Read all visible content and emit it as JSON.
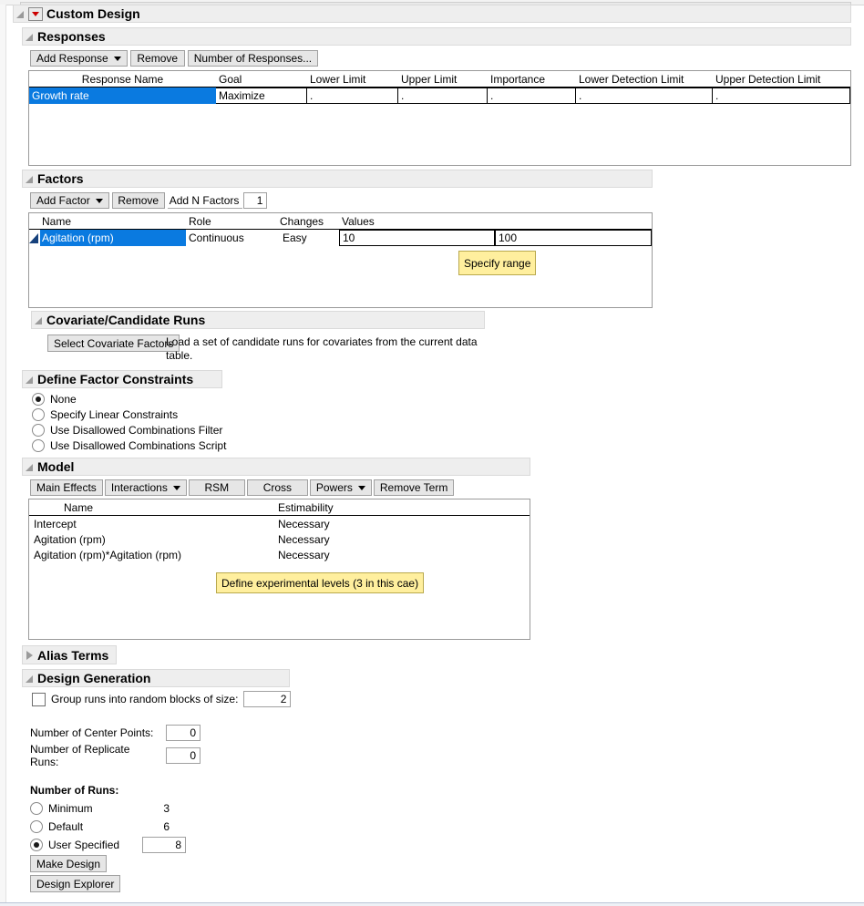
{
  "window": {
    "title": "Custom Design",
    "dropdown_icon": "red-triangle-dropdown-icon"
  },
  "responses": {
    "section_title": "Responses",
    "toolbar": {
      "add_response": "Add Response",
      "remove": "Remove",
      "number_of_responses": "Number of Responses..."
    },
    "columns": [
      "Response Name",
      "Goal",
      "Lower Limit",
      "Upper Limit",
      "Importance",
      "Lower Detection Limit",
      "Upper Detection Limit"
    ],
    "rows": [
      {
        "name": "Growth rate",
        "goal": "Maximize",
        "lower_limit": ".",
        "upper_limit": ".",
        "importance": ".",
        "lower_detection_limit": ".",
        "upper_detection_limit": "."
      }
    ]
  },
  "factors": {
    "section_title": "Factors",
    "toolbar": {
      "add_factor": "Add Factor",
      "remove": "Remove",
      "add_n_factors": "Add N Factors",
      "add_n_factors_value": "1"
    },
    "columns": [
      "Name",
      "Role",
      "Changes",
      "Values"
    ],
    "rows": [
      {
        "name": "Agitation (rpm)",
        "role": "Continuous",
        "changes": "Easy",
        "value_low": "10",
        "value_high": "100"
      }
    ],
    "callout": "Specify range"
  },
  "covariate": {
    "section_title": "Covariate/Candidate Runs",
    "button": "Select Covariate Factors",
    "description": "Load a set of candidate runs for covariates from the current data table."
  },
  "constraints": {
    "section_title": "Define Factor Constraints",
    "options": [
      {
        "label": "None",
        "selected": true
      },
      {
        "label": "Specify Linear Constraints",
        "selected": false
      },
      {
        "label": "Use Disallowed Combinations Filter",
        "selected": false
      },
      {
        "label": "Use Disallowed Combinations Script",
        "selected": false
      }
    ]
  },
  "model": {
    "section_title": "Model",
    "toolbar": {
      "main_effects": "Main Effects",
      "interactions": "Interactions",
      "rsm": "RSM",
      "cross": "Cross",
      "powers": "Powers",
      "remove_term": "Remove Term"
    },
    "columns": [
      "Name",
      "Estimability"
    ],
    "rows": [
      {
        "name": "Intercept",
        "estimability": "Necessary"
      },
      {
        "name": "Agitation (rpm)",
        "estimability": "Necessary"
      },
      {
        "name": "Agitation (rpm)*Agitation (rpm)",
        "estimability": "Necessary"
      }
    ],
    "callout": "Define experimental levels (3 in this cae)"
  },
  "alias_terms": {
    "section_title": "Alias Terms",
    "collapsed": true
  },
  "design_generation": {
    "section_title": "Design Generation",
    "group_runs_label": "Group runs into random blocks of size:",
    "group_runs_checked": false,
    "group_runs_value": "2",
    "center_points_label": "Number of Center Points:",
    "center_points_value": "0",
    "replicate_runs_label": "Number of Replicate Runs:",
    "replicate_runs_value": "0",
    "number_of_runs_label": "Number of Runs:",
    "run_options": [
      {
        "label": "Minimum",
        "value": "3",
        "selected": false
      },
      {
        "label": "Default",
        "value": "6",
        "selected": false
      },
      {
        "label": "User Specified",
        "value": "8",
        "selected": true
      }
    ],
    "make_design": "Make Design",
    "design_explorer": "Design Explorer"
  },
  "colors": {
    "selection_blue": "#0a7ae0",
    "callout_yellow": "#ffef9e",
    "section_gray": "#eeeeee",
    "dropdown_red": "#cc0000"
  }
}
